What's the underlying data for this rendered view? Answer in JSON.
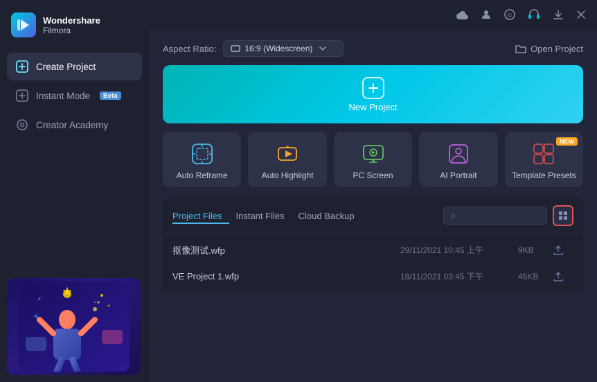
{
  "app": {
    "name": "Wondershare",
    "name2": "Filmora"
  },
  "sidebar": {
    "items": [
      {
        "id": "create-project",
        "label": "Create Project",
        "active": true
      },
      {
        "id": "instant-mode",
        "label": "Instant Mode",
        "badge": "Beta"
      },
      {
        "id": "creator-academy",
        "label": "Creator Academy"
      }
    ]
  },
  "topbar": {
    "icons": [
      "cloud",
      "person",
      "copyright",
      "headphone",
      "download",
      "close"
    ]
  },
  "aspect_ratio": {
    "label": "Aspect Ratio:",
    "value": "16:9 (Widescreen)"
  },
  "open_project": {
    "label": "Open Project"
  },
  "new_project": {
    "label": "New Project"
  },
  "action_cards": [
    {
      "id": "auto-reframe",
      "label": "Auto Reframe",
      "new": false
    },
    {
      "id": "auto-highlight",
      "label": "Auto Highlight",
      "new": false
    },
    {
      "id": "pc-screen",
      "label": "PC Screen",
      "new": false
    },
    {
      "id": "ai-portrait",
      "label": "AI Portrait",
      "new": false
    },
    {
      "id": "template-presets",
      "label": "Template Presets",
      "new": true
    }
  ],
  "project_files": {
    "tabs": [
      {
        "id": "project-files",
        "label": "Project Files",
        "active": true
      },
      {
        "id": "instant-files",
        "label": "Instant Files",
        "active": false
      },
      {
        "id": "cloud-backup",
        "label": "Cloud Backup",
        "active": false
      }
    ],
    "search_placeholder": "Search",
    "files": [
      {
        "name": "抠像测试.wfp",
        "date": "29/11/2021 10:45 上午",
        "size": "9KB"
      },
      {
        "name": "VE Project 1.wfp",
        "date": "18/11/2021 03:45 下午",
        "size": "45KB"
      }
    ]
  }
}
